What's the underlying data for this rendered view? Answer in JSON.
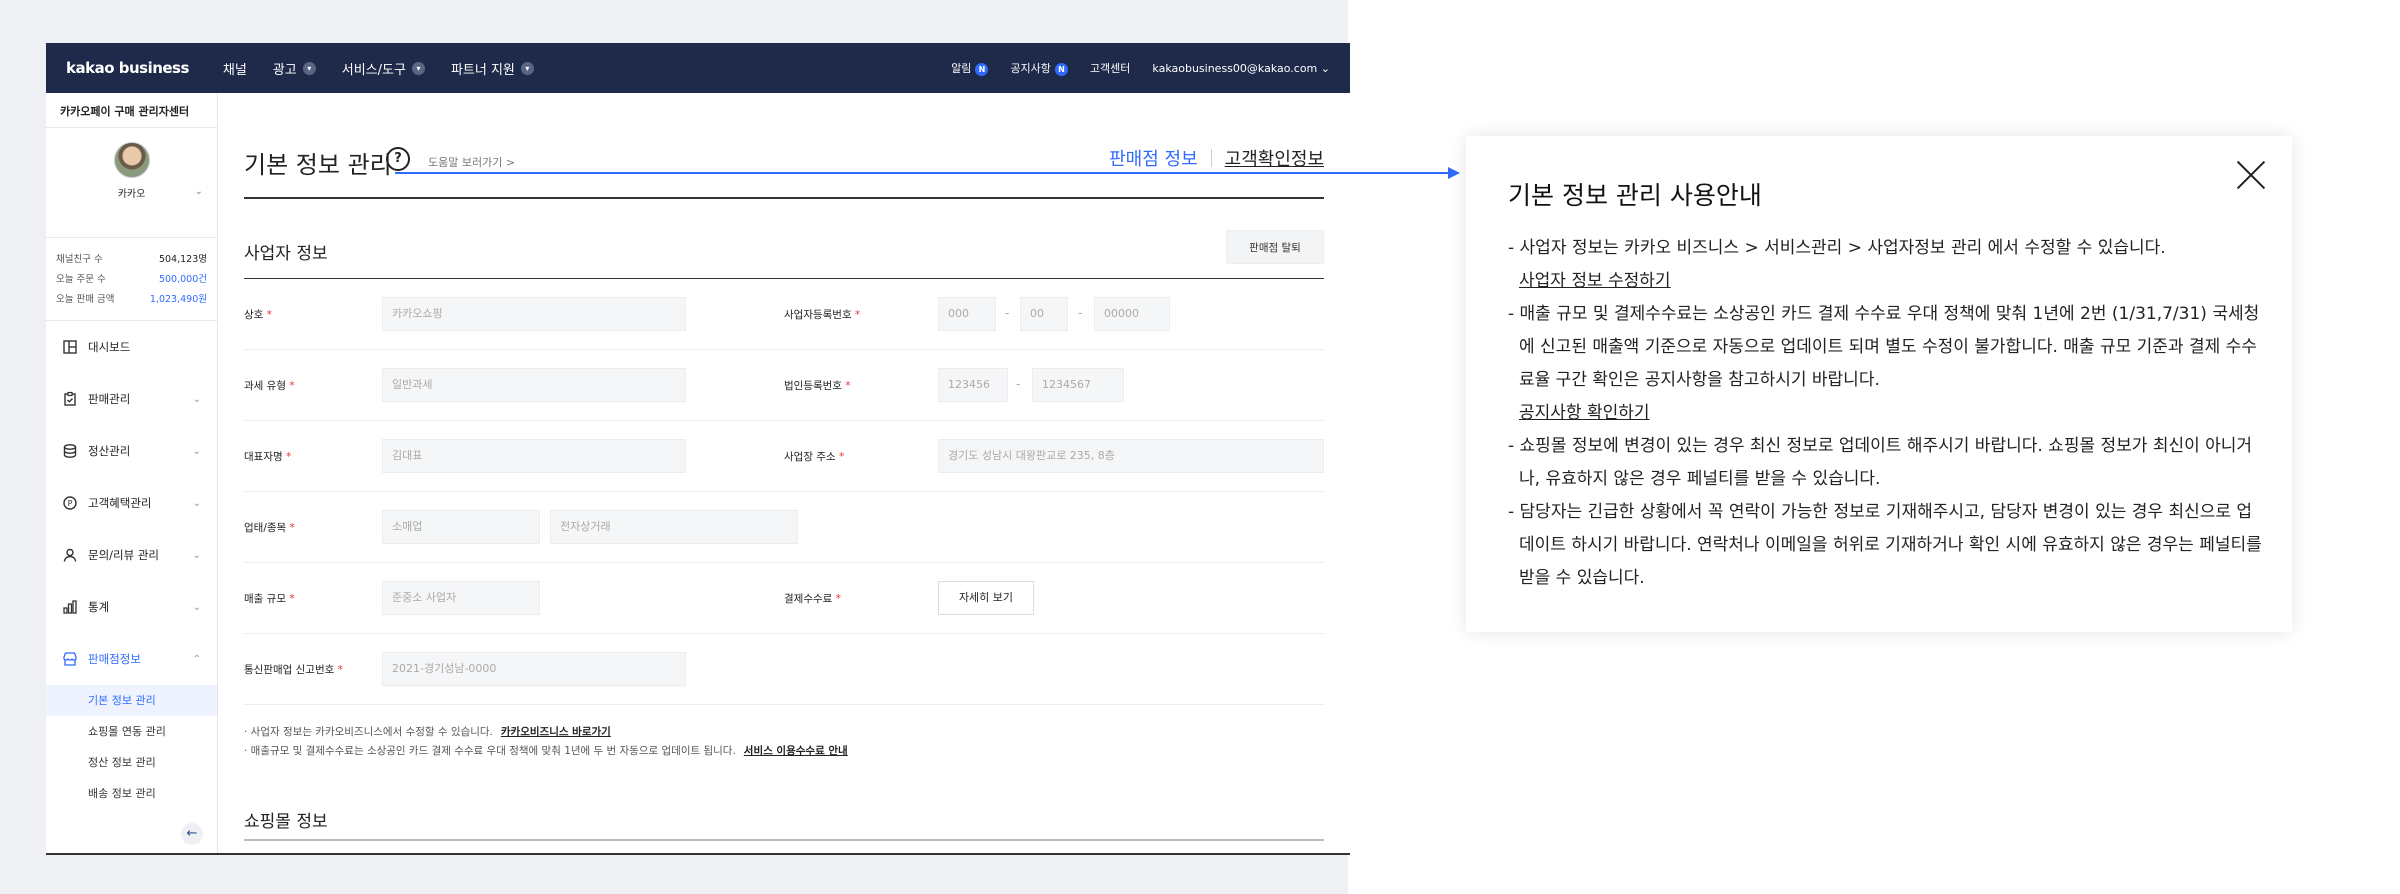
{
  "topnav": {
    "brand": "kakao business",
    "items": [
      "채널",
      "광고",
      "서비스/도구",
      "파트너 지원"
    ],
    "right": {
      "alarm": "알림",
      "notice": "공지사항",
      "new_badge": "N",
      "support": "고객센터",
      "account": "kakaobusiness00@kakao.com"
    }
  },
  "sidebar": {
    "title": "카카오페이 구매 관리자센터",
    "profile_name": "카카오",
    "stats": [
      {
        "label": "채널친구 수",
        "value": "504,123명"
      },
      {
        "label": "오늘 주문 수",
        "value": "500,000건"
      },
      {
        "label": "오늘 판매 금액",
        "value": "1,023,490원"
      }
    ],
    "menu": [
      {
        "label": "대시보드",
        "icon": "dashboard-icon"
      },
      {
        "label": "판매관리",
        "icon": "clipboard-check-icon"
      },
      {
        "label": "정산관리",
        "icon": "database-icon"
      },
      {
        "label": "고객혜택관리",
        "icon": "coupon-icon"
      },
      {
        "label": "문의/리뷰 관리",
        "icon": "person-icon"
      },
      {
        "label": "통계",
        "icon": "bar-chart-icon"
      },
      {
        "label": "판매점정보",
        "icon": "store-icon"
      }
    ],
    "submenu": [
      "기본 정보 관리",
      "쇼핑몰 연동 관리",
      "정산 정보 관리",
      "배송 정보 관리"
    ]
  },
  "page": {
    "title": "기본 정보 관리",
    "help_link": "도움말 보러가기 >",
    "tabs": [
      "판매점 정보",
      "고객확인정보"
    ]
  },
  "business_section": {
    "title": "사업자 정보",
    "leave_button": "판매점 탈퇴",
    "fields": {
      "company_label": "상호",
      "company_value": "카카오쇼핑",
      "reg_no_label": "사업자등록번호",
      "reg_no_parts": [
        "000",
        "00",
        "00000"
      ],
      "tax_label": "과세 유형",
      "tax_value": "일반과세",
      "corp_no_label": "법인등록번호",
      "corp_no_parts": [
        "123456",
        "1234567"
      ],
      "ceo_label": "대표자명",
      "ceo_value": "김대표",
      "address_label": "사업장 주소",
      "address_value": "경기도 성남시 대왕판교로 235, 8층",
      "industry_label": "업태/종목",
      "industry_values": [
        "소매업",
        "전자상거래"
      ],
      "scale_label": "매출 규모",
      "scale_value": "준중소 사업자",
      "fee_label": "결제수수료",
      "fee_button": "자세히 보기",
      "ecommerce_label": "통신판매업 신고번호",
      "ecommerce_value": "2021-경기성남-0000"
    },
    "notes": [
      {
        "text": "· 사업자 정보는 카카오비즈니스에서 수정할 수 있습니다.",
        "link": "카카오비즈니스 바로가기"
      },
      {
        "text": "· 매출규모 및 결제수수료는 소상공인 카드 결제 수수료 우대 정책에 맞춰 1년에 두 번 자동으로 업데이트 됩니다.",
        "link": "서비스 이용수수료 안내"
      }
    ]
  },
  "shop_section": {
    "title": "쇼핑몰 정보"
  },
  "panel": {
    "title": "기본 정보 관리 사용안내",
    "items": [
      {
        "text": "- 사업자 정보는 카카오 비즈니스 > 서비스관리 > 사업자정보 관리 에서 수정할 수 있습니다.",
        "link": "사업자 정보 수정하기"
      },
      {
        "text": "- 매출 규모 및 결제수수료는 소상공인 카드 결제 수수료 우대 정책에 맞춰 1년에 2번 (1/31,7/31) 국세청에 신고된 매출액 기준으로 자동으로 업데이트 되며 별도 수정이 불가합니다. 매출 규모 기준과 결제 수수료율 구간 확인은 공지사항을 참고하시기 바랍니다.",
        "link": "공지사항 확인하기"
      },
      {
        "text": "- 쇼핑몰 정보에 변경이 있는 경우 최신 정보로 업데이트 해주시기 바랍니다. 쇼핑몰 정보가 최신이 아니거나, 유효하지 않은 경우 페널티를 받을 수 있습니다.",
        "link": null
      },
      {
        "text": "- 담당자는 긴급한 상황에서 꼭 연락이 가능한 정보로 기재해주시고, 담당자 변경이 있는 경우 최신으로 업데이트 하시기 바랍니다. 연락처나 이메일을 허위로 기재하거나 확인 시에 유효하지 않은 경우는 페널티를 받을 수 있습니다.",
        "link": null
      }
    ]
  },
  "colors": {
    "nav_bg": "#1f2a4a",
    "accent": "#2f6bff",
    "required": "#e8343a"
  }
}
